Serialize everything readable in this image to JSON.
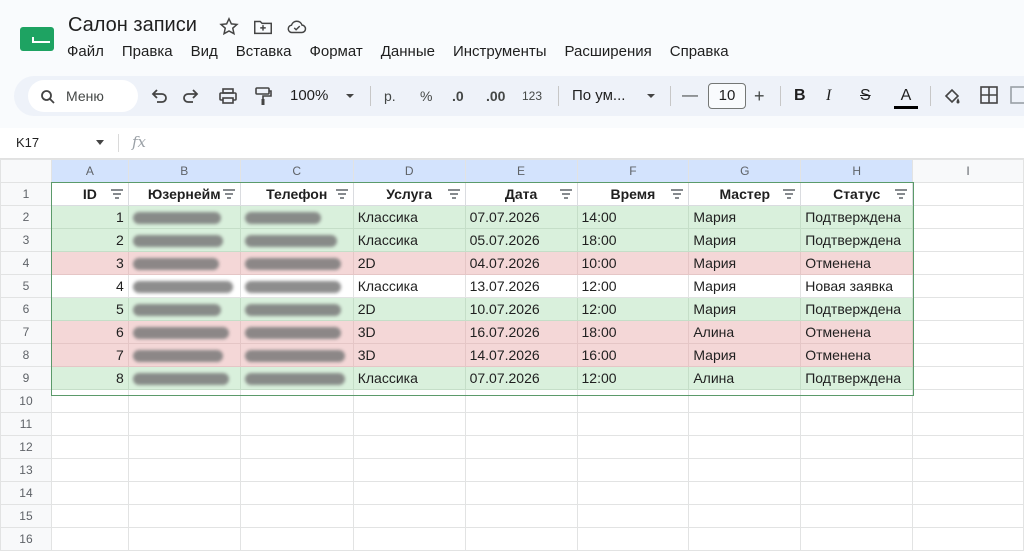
{
  "app": {
    "title": "Салон записи",
    "menu": [
      "Файл",
      "Правка",
      "Вид",
      "Вставка",
      "Формат",
      "Данные",
      "Инструменты",
      "Расширения",
      "Справка"
    ]
  },
  "toolbar": {
    "search_label": "Меню",
    "zoom": "100%",
    "currency": "р.",
    "percent": "%",
    "dec_decrease": ".0",
    "dec_increase": ".00",
    "format_123": "123",
    "font": "По ум...",
    "font_size": "10",
    "minus": "—",
    "plus": "+",
    "bold": "B",
    "italic": "I",
    "strike": "S",
    "text_color": "A"
  },
  "formula": {
    "cell_ref": "K17",
    "fx": "fx",
    "value": ""
  },
  "sheet": {
    "columns": [
      "A",
      "B",
      "C",
      "D",
      "E",
      "F",
      "G",
      "H",
      "I"
    ],
    "row_numbers": [
      "1",
      "2",
      "3",
      "4",
      "5",
      "6",
      "7",
      "8",
      "9",
      "10",
      "11",
      "12",
      "13",
      "14",
      "15",
      "16"
    ],
    "headers": [
      "ID",
      "Юзернейм",
      "Телефон",
      "Услуга",
      "Дата",
      "Время",
      "Мастер",
      "Статус"
    ],
    "rows": [
      {
        "id": "1",
        "service": "Классика",
        "date": "07.07.2026",
        "time": "14:00",
        "master": "Мария",
        "status": "Подтверждена",
        "color": "green"
      },
      {
        "id": "2",
        "service": "Классика",
        "date": "05.07.2026",
        "time": "18:00",
        "master": "Мария",
        "status": "Подтверждена",
        "color": "green"
      },
      {
        "id": "3",
        "service": "2D",
        "date": "04.07.2026",
        "time": "10:00",
        "master": "Мария",
        "status": "Отменена",
        "color": "red"
      },
      {
        "id": "4",
        "service": "Классика",
        "date": "13.07.2026",
        "time": "12:00",
        "master": "Мария",
        "status": "Новая заявка",
        "color": "white"
      },
      {
        "id": "5",
        "service": "2D",
        "date": "10.07.2026",
        "time": "12:00",
        "master": "Мария",
        "status": "Подтверждена",
        "color": "green"
      },
      {
        "id": "6",
        "service": "3D",
        "date": "16.07.2026",
        "time": "18:00",
        "master": "Алина",
        "status": "Отменена",
        "color": "red"
      },
      {
        "id": "7",
        "service": "3D",
        "date": "14.07.2026",
        "time": "16:00",
        "master": "Мария",
        "status": "Отменена",
        "color": "red"
      },
      {
        "id": "8",
        "service": "Классика",
        "date": "07.07.2026",
        "time": "12:00",
        "master": "Алина",
        "status": "Подтверждена",
        "color": "green"
      }
    ]
  },
  "colors": {
    "confirmed": "#d9f0dc",
    "cancelled": "#f4d7d7",
    "selected_header": "#d3e3fd",
    "logo": "#1ea362"
  }
}
